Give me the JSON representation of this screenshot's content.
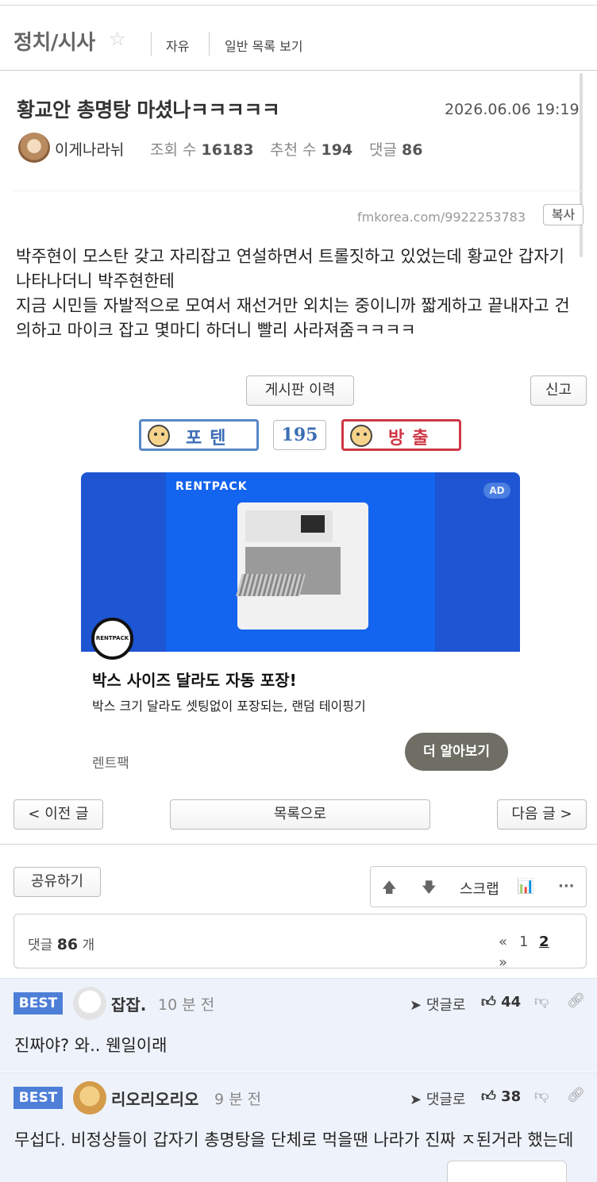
{
  "board": {
    "title": "정치/시사",
    "star_icon": "☆",
    "category": "자유",
    "view_all": "일반 목록 보기"
  },
  "post": {
    "title": "황교안 총명탕 마셨나ㅋㅋㅋㅋㅋ",
    "date": "2026.06.06 19:19",
    "author": "이게나라뉘",
    "views_label": "조회 수",
    "views": "16183",
    "recommends_label": "추천 수",
    "recommends": "194",
    "comments_label": "댓글",
    "comments": "86",
    "url": "fmkorea.com/9922253783",
    "copy_label": "복사",
    "body": [
      "박주현이 모스탄 갖고 자리잡고 연설하면서 트롤짓하고 있었는데 황교안 갑자기 나타나더니 박주현한테",
      "지금 시민들 자발적으로 모여서 재선거만 외치는 중이니까 짧게하고 끝내자고 건의하고 마이크 잡고 몇마디 하더니 빨리 사라져줌ㅋㅋㅋㅋ"
    ]
  },
  "actions": {
    "history": "게시판 이력",
    "report": "신고",
    "vote_up": "포텐",
    "vote_count": "195",
    "vote_down": "방출"
  },
  "ad": {
    "brand_top": "RENTPACK",
    "brand_logo": "RENTPACK",
    "badge": "AD",
    "headline": "박스 사이즈 달라도 자동 포장!",
    "description": "박스 크기 달라도 셋팅없이 포장되는, 랜덤 테이핑기",
    "advertiser": "렌트팩",
    "cta": "더 알아보기",
    "bg_color": "#1e55d3"
  },
  "nav": {
    "prev": "< 이전 글",
    "list": "목록으로",
    "next": "다음 글 >"
  },
  "share": {
    "label": "공유하기",
    "up_icon": "🡅",
    "down_icon": "🡇",
    "scrap": "스크랩",
    "stats_icon": "📊",
    "more_icon": "···"
  },
  "comments_header": {
    "label": "댓글",
    "count": "86",
    "unit": "개",
    "first": "«",
    "page1": "1",
    "page2": "2",
    "last": "»"
  },
  "comments": [
    {
      "badge": "BEST",
      "name": "잡잡.",
      "time": "10 분 전",
      "reply": "댓글로",
      "likes": "44",
      "text": "진짜야? 와.. 웬일이래"
    },
    {
      "badge": "BEST",
      "name": "리오리오리오",
      "time": "9 분 전",
      "reply": "댓글로",
      "likes": "38",
      "text": "무섭다. 비정상들이 갑자기 총명탕을 단체로 먹을땐 나라가 진짜 ㅈ된거라 했는데"
    }
  ]
}
